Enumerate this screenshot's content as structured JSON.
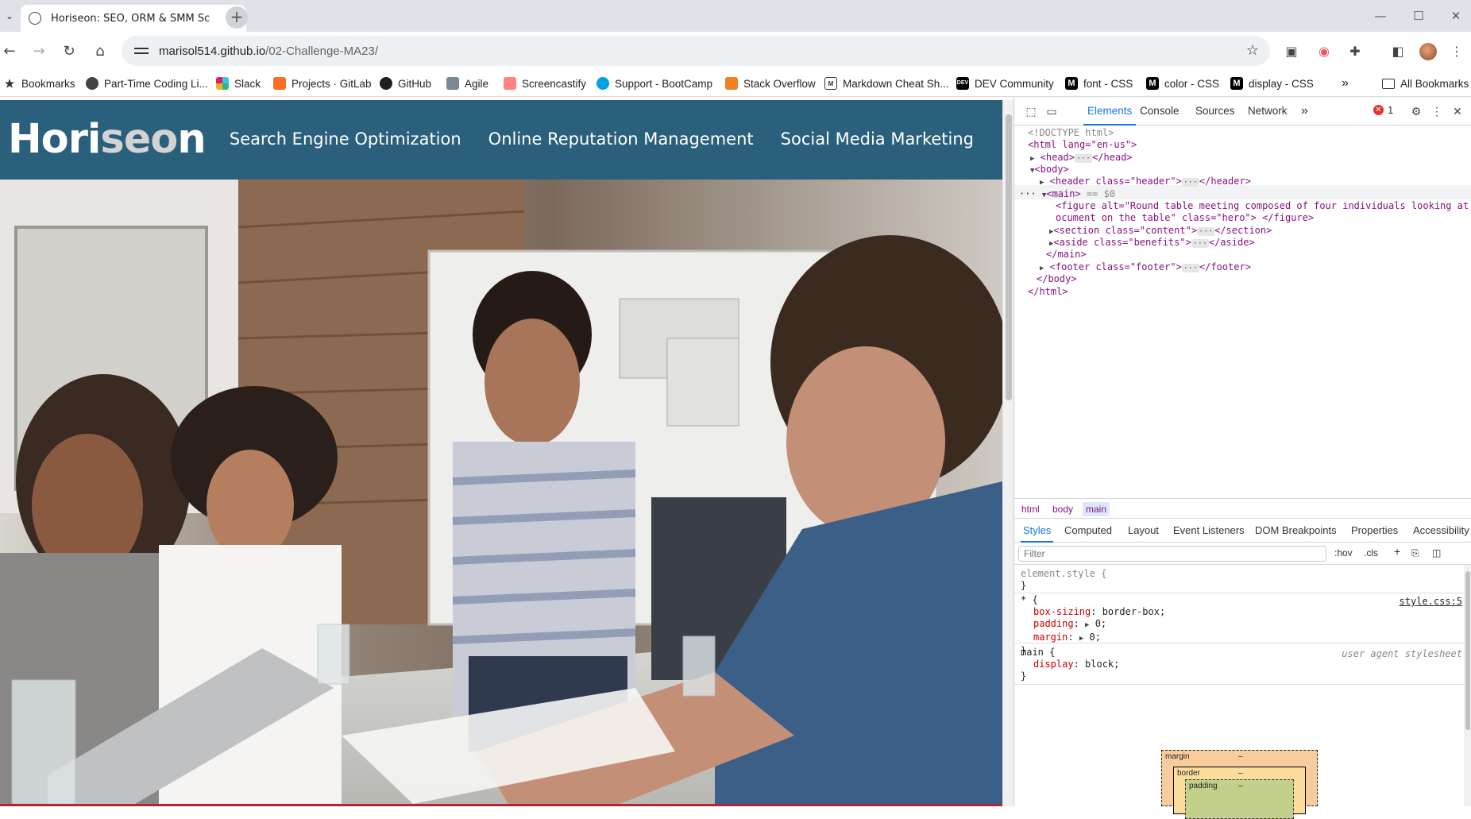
{
  "browser": {
    "tab": {
      "title": "Horiseon: SEO, ORM & SMM Sc",
      "close": "✕"
    },
    "new_tab": "+",
    "window": {
      "minimize": "—",
      "maximize": "☐",
      "close": "✕"
    },
    "url": {
      "host": "marisol514.github.io",
      "path": "/02-Challenge-MA23/"
    },
    "bookmarks": [
      {
        "label": "Bookmarks",
        "icon": "star-icon"
      },
      {
        "label": "Part-Time Coding Li...",
        "icon": "globe-icon"
      },
      {
        "label": "Slack",
        "icon": "slack-icon"
      },
      {
        "label": "Projects · GitLab",
        "icon": "gitlab-icon"
      },
      {
        "label": "GitHub",
        "icon": "github-icon"
      },
      {
        "label": "Agile",
        "icon": "agile-icon"
      },
      {
        "label": "Screencastify",
        "icon": "screencastify-icon"
      },
      {
        "label": "Support - BootCamp",
        "icon": "salesforce-icon"
      },
      {
        "label": "Stack Overflow",
        "icon": "stackoverflow-icon"
      },
      {
        "label": "Markdown Cheat Sh...",
        "icon": "markdown-icon"
      },
      {
        "label": "DEV Community",
        "icon": "dev-icon"
      },
      {
        "label": "font - CSS",
        "icon": "mdn-icon"
      },
      {
        "label": "color - CSS",
        "icon": "mdn-icon"
      },
      {
        "label": "display - CSS",
        "icon": "mdn-icon"
      }
    ],
    "bookmarks_overflow": "»",
    "all_bookmarks": "All Bookmarks"
  },
  "site": {
    "logo_hori": "Hori",
    "logo_seo": "seo",
    "logo_n": "n",
    "nav": [
      "Search Engine Optimization",
      "Online Reputation Management",
      "Social Media Marketing"
    ],
    "hero_alt": "Round table meeting composed of four individuals looking at a document on the table"
  },
  "devtools": {
    "tabs": [
      "Elements",
      "Console",
      "Sources",
      "Network"
    ],
    "more_tabs": "»",
    "error_count": "1",
    "dom": {
      "doctype": "<!DOCTYPE html>",
      "html_open": "<html lang=\"en-us\">",
      "head": "<head>",
      "head_close": "</head>",
      "body": "<body>",
      "header_tag": "<header class=\"header\">",
      "header_close": "</header>",
      "main": "<main>",
      "main_marker": "== $0",
      "figure_1": "<figure alt=\"Round table meeting composed of four individuals looking at a d",
      "figure_2": "ocument on the table\" class=\"hero\"> </figure>",
      "section_tag": "<section class=\"content\">",
      "section_close": "</section>",
      "aside_tag": "<aside class=\"benefits\">",
      "aside_close": "</aside>",
      "main_close": "</main>",
      "footer_tag": "<footer class=\"footer\">",
      "footer_close": "</footer>",
      "body_close": "</body>",
      "html_close": "</html>",
      "ellipsis": "···"
    },
    "breadcrumbs": [
      "html",
      "body",
      "main"
    ],
    "style_tabs": [
      "Styles",
      "Computed",
      "Layout",
      "Event Listeners",
      "DOM Breakpoints",
      "Properties",
      "Accessibility"
    ],
    "filter_placeholder": "Filter",
    "hov": ":hov",
    "cls": ".cls",
    "rules": {
      "element_style": "element.style {",
      "close_brace": "}",
      "star_sel": "* {",
      "star_src": "style.css:5",
      "box_sizing": "box-sizing",
      "box_sizing_val": "border-box;",
      "padding": "padding",
      "padding_val": "0;",
      "margin": "margin",
      "margin_val": "0;",
      "main_sel": "main {",
      "main_src": "user agent stylesheet",
      "display": "display",
      "display_val": "block;"
    },
    "box_model": {
      "margin": "margin",
      "border": "border",
      "padding": "padding",
      "dash": "–"
    }
  }
}
